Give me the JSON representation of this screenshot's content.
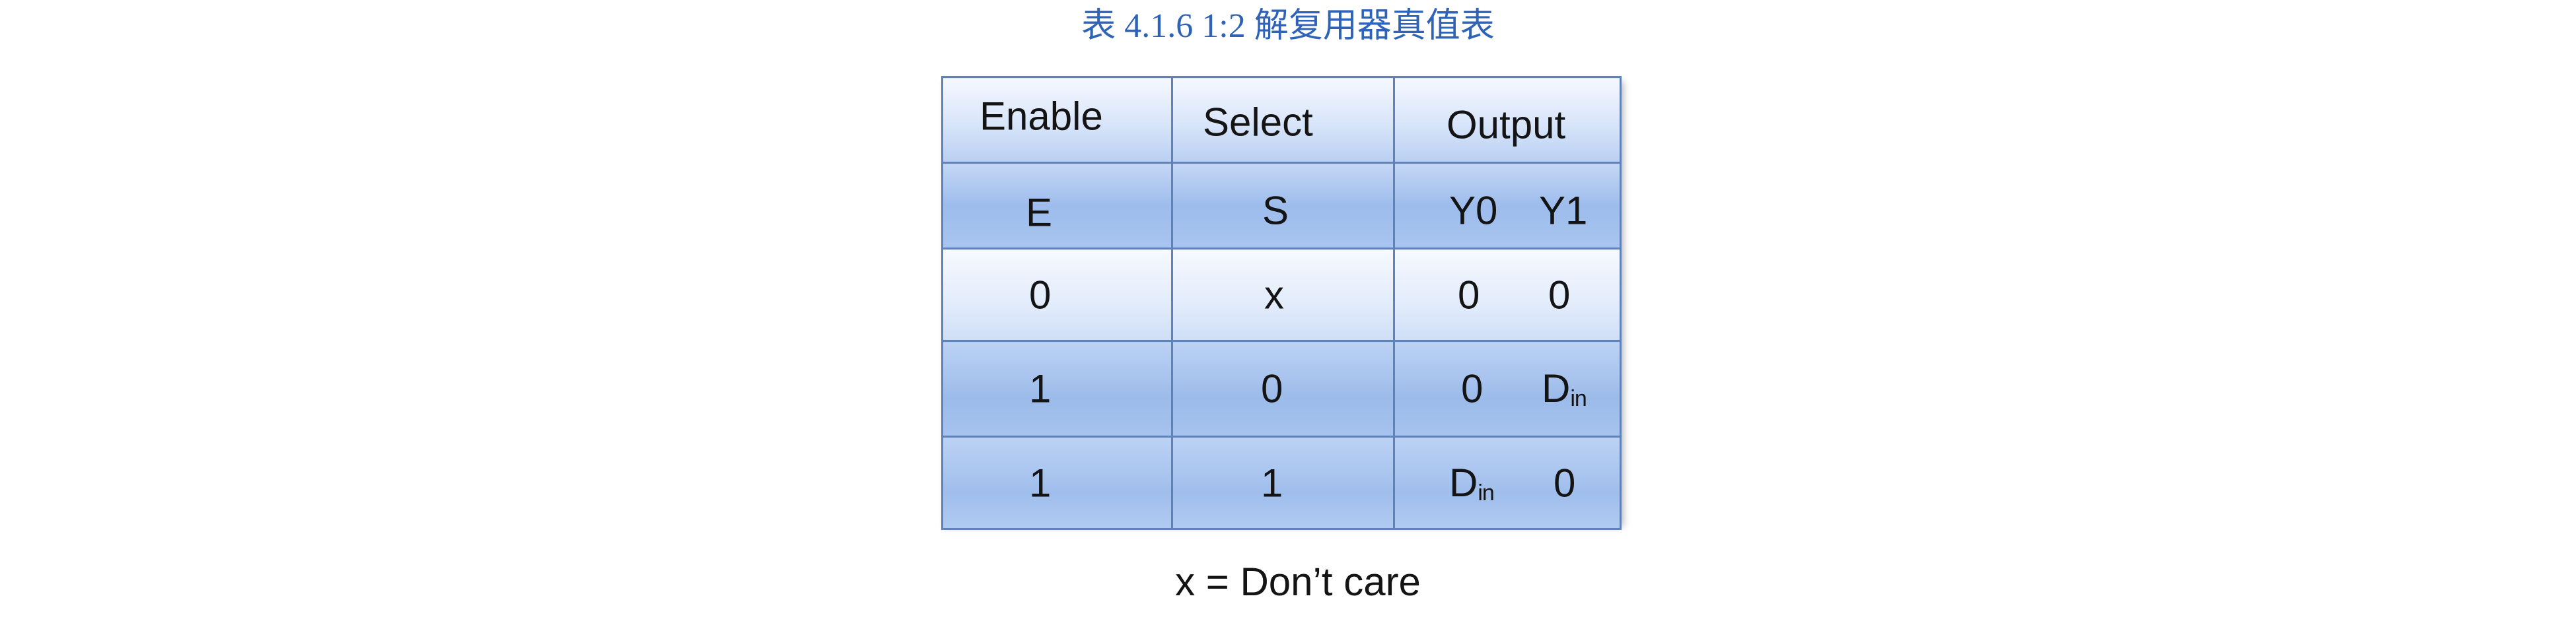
{
  "caption": "表 4.1.6 1:2 解复用器真值表",
  "table": {
    "headers": {
      "enable": "Enable",
      "select": "Select",
      "output": "Output"
    },
    "symbols": {
      "e": "E",
      "s": "S",
      "y0": "Y0",
      "y1": "Y1"
    },
    "rows": [
      {
        "e": "0",
        "s": "x",
        "y0": "0",
        "y1": "0"
      },
      {
        "e": "1",
        "s": "0",
        "y0": "0",
        "y1": {
          "base": "D",
          "sub": "in"
        }
      },
      {
        "e": "1",
        "s": "1",
        "y0": {
          "base": "D",
          "sub": "in"
        },
        "y1": "0"
      }
    ]
  },
  "note": "x = Don’t care"
}
